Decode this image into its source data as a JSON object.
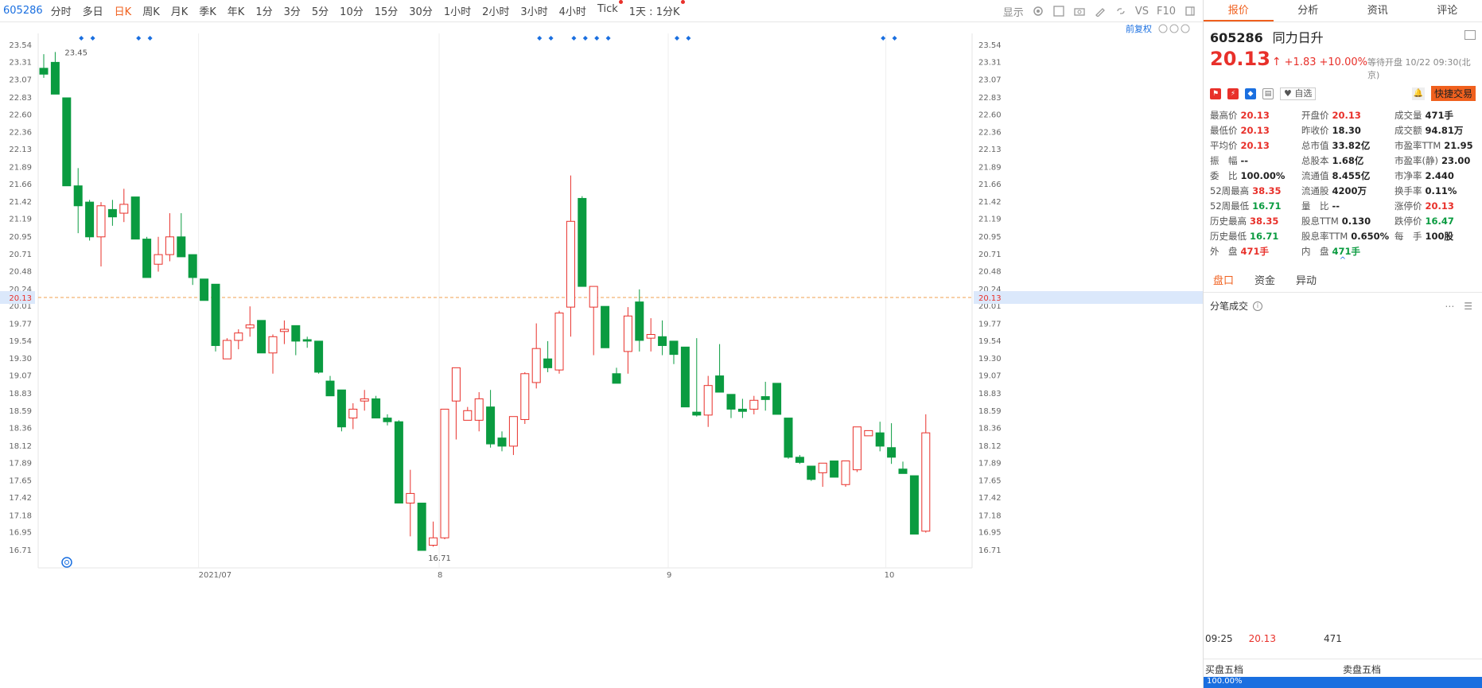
{
  "toolbar": {
    "code": "605286",
    "periods": [
      "分时",
      "多日",
      "日K",
      "周K",
      "月K",
      "季K",
      "年K",
      "1分",
      "3分",
      "5分",
      "10分",
      "15分",
      "30分",
      "1小时",
      "2小时",
      "3小时",
      "4小时",
      "Tick",
      "1天 : 1分K"
    ],
    "active_period": "日K",
    "display": "显示",
    "vs": "VS",
    "f10": "F10",
    "restore": "前复权"
  },
  "right_panel": {
    "tabs": [
      "报价",
      "分析",
      "资讯",
      "评论"
    ],
    "code": "605286",
    "name": "同力日升",
    "price": "20.13",
    "change": "+1.83",
    "change_pct": "+10.00%",
    "status": "等待开盘 10/22 09:30(北京)",
    "favorite": "自选",
    "fast_trade": "快捷交易",
    "quotes": [
      [
        {
          "l": "最高价",
          "v": "20.13",
          "c": "red"
        },
        {
          "l": "开盘价",
          "v": "20.13",
          "c": "red"
        },
        {
          "l": "成交量",
          "v": "471手",
          "c": ""
        }
      ],
      [
        {
          "l": "最低价",
          "v": "20.13",
          "c": "red"
        },
        {
          "l": "昨收价",
          "v": "18.30",
          "c": ""
        },
        {
          "l": "成交额",
          "v": "94.81万",
          "c": ""
        }
      ],
      [
        {
          "l": "平均价",
          "v": "20.13",
          "c": "red"
        },
        {
          "l": "总市值",
          "v": "33.82亿",
          "c": ""
        },
        {
          "l": "市盈率TTM",
          "v": "21.95",
          "c": ""
        }
      ],
      [
        {
          "l": "振　幅",
          "v": "--",
          "c": ""
        },
        {
          "l": "总股本",
          "v": "1.68亿",
          "c": ""
        },
        {
          "l": "市盈率(静)",
          "v": "23.00",
          "c": ""
        }
      ],
      [
        {
          "l": "委　比",
          "v": "100.00%",
          "c": ""
        },
        {
          "l": "流通值",
          "v": "8.455亿",
          "c": ""
        },
        {
          "l": "市净率",
          "v": "2.440",
          "c": ""
        }
      ],
      [
        {
          "l": "52周最高",
          "v": "38.35",
          "c": "red"
        },
        {
          "l": "流通股",
          "v": "4200万",
          "c": ""
        },
        {
          "l": "换手率",
          "v": "0.11%",
          "c": ""
        }
      ],
      [
        {
          "l": "52周最低",
          "v": "16.71",
          "c": "green"
        },
        {
          "l": "量　比",
          "v": "--",
          "c": ""
        },
        {
          "l": "涨停价",
          "v": "20.13",
          "c": "red"
        }
      ],
      [
        {
          "l": "历史最高",
          "v": "38.35",
          "c": "red"
        },
        {
          "l": "股息TTM",
          "v": "0.130",
          "c": ""
        },
        {
          "l": "跌停价",
          "v": "16.47",
          "c": "green"
        }
      ],
      [
        {
          "l": "历史最低",
          "v": "16.71",
          "c": "green"
        },
        {
          "l": "股息率TTM",
          "v": "0.650%",
          "c": ""
        },
        {
          "l": "每　手",
          "v": "100股",
          "c": ""
        }
      ],
      [
        {
          "l": "外　盘",
          "v": "471手",
          "c": "red"
        },
        {
          "l": "内　盘",
          "v": "471手",
          "c": "green"
        },
        {
          "l": "",
          "v": "",
          "c": ""
        }
      ]
    ],
    "sub_tabs": [
      "盘口",
      "资金",
      "异动"
    ],
    "trade_title": "分笔成交",
    "trade": {
      "time": "09:25",
      "price": "20.13",
      "vol": "471"
    },
    "book_buy": "买盘五档",
    "book_sell": "卖盘五档",
    "book_bar": "100.00%"
  },
  "chart_data": {
    "type": "candlestick",
    "title": "",
    "y_ticks": [
      "23.54",
      "23.31",
      "23.07",
      "22.83",
      "22.60",
      "22.36",
      "22.13",
      "21.89",
      "21.66",
      "21.42",
      "21.19",
      "20.95",
      "20.71",
      "20.48",
      "20.24",
      "20.01",
      "19.77",
      "19.54",
      "19.30",
      "19.07",
      "18.83",
      "18.59",
      "18.36",
      "18.12",
      "17.89",
      "17.65",
      "17.42",
      "17.18",
      "16.95",
      "16.71"
    ],
    "ylim": [
      16.71,
      23.54
    ],
    "x_labels": [
      {
        "label": "2021/07",
        "index": 14
      },
      {
        "label": "8",
        "index": 35
      },
      {
        "label": "9",
        "index": 55
      },
      {
        "label": "10",
        "index": 74
      }
    ],
    "last_price_line": 20.13,
    "last_price_label": "20.13",
    "max_label": "23.45",
    "min_label": "16.71",
    "candles": [
      {
        "o": 23.23,
        "h": 23.42,
        "l": 23.1,
        "c": 23.15
      },
      {
        "o": 23.31,
        "h": 23.45,
        "l": 22.88,
        "c": 22.88
      },
      {
        "o": 22.83,
        "h": 22.83,
        "l": 21.64,
        "c": 21.64
      },
      {
        "o": 21.64,
        "h": 21.88,
        "l": 21.0,
        "c": 21.37
      },
      {
        "o": 21.42,
        "h": 21.45,
        "l": 20.9,
        "c": 20.95
      },
      {
        "o": 20.95,
        "h": 21.42,
        "l": 20.55,
        "c": 21.37
      },
      {
        "o": 21.32,
        "h": 21.45,
        "l": 21.1,
        "c": 21.22
      },
      {
        "o": 21.27,
        "h": 21.6,
        "l": 21.15,
        "c": 21.39
      },
      {
        "o": 21.49,
        "h": 21.49,
        "l": 20.92,
        "c": 20.92
      },
      {
        "o": 20.92,
        "h": 20.95,
        "l": 20.4,
        "c": 20.4
      },
      {
        "o": 20.58,
        "h": 20.95,
        "l": 20.48,
        "c": 20.71
      },
      {
        "o": 20.71,
        "h": 21.27,
        "l": 20.62,
        "c": 20.95
      },
      {
        "o": 20.95,
        "h": 21.27,
        "l": 20.68,
        "c": 20.68
      },
      {
        "o": 20.71,
        "h": 20.71,
        "l": 20.3,
        "c": 20.4
      },
      {
        "o": 20.38,
        "h": 20.38,
        "l": 20.09,
        "c": 20.09
      },
      {
        "o": 20.31,
        "h": 20.31,
        "l": 19.4,
        "c": 19.48
      },
      {
        "o": 19.3,
        "h": 19.58,
        "l": 19.3,
        "c": 19.55
      },
      {
        "o": 19.55,
        "h": 19.7,
        "l": 19.43,
        "c": 19.65
      },
      {
        "o": 19.72,
        "h": 20.01,
        "l": 19.6,
        "c": 19.76
      },
      {
        "o": 19.82,
        "h": 19.82,
        "l": 19.38,
        "c": 19.38
      },
      {
        "o": 19.38,
        "h": 19.63,
        "l": 19.1,
        "c": 19.6
      },
      {
        "o": 19.67,
        "h": 19.82,
        "l": 19.5,
        "c": 19.7
      },
      {
        "o": 19.75,
        "h": 19.75,
        "l": 19.35,
        "c": 19.54
      },
      {
        "o": 19.56,
        "h": 19.6,
        "l": 19.45,
        "c": 19.54
      },
      {
        "o": 19.54,
        "h": 19.54,
        "l": 19.1,
        "c": 19.12
      },
      {
        "o": 19.0,
        "h": 19.07,
        "l": 18.8,
        "c": 18.8
      },
      {
        "o": 18.88,
        "h": 18.88,
        "l": 18.32,
        "c": 18.38
      },
      {
        "o": 18.5,
        "h": 18.7,
        "l": 18.35,
        "c": 18.62
      },
      {
        "o": 18.73,
        "h": 18.88,
        "l": 18.6,
        "c": 18.76
      },
      {
        "o": 18.76,
        "h": 18.8,
        "l": 18.5,
        "c": 18.5
      },
      {
        "o": 18.5,
        "h": 18.55,
        "l": 18.4,
        "c": 18.45
      },
      {
        "o": 18.45,
        "h": 18.47,
        "l": 17.35,
        "c": 17.35
      },
      {
        "o": 17.35,
        "h": 17.8,
        "l": 16.9,
        "c": 17.48
      },
      {
        "o": 17.35,
        "h": 17.35,
        "l": 16.71,
        "c": 16.71
      },
      {
        "o": 16.78,
        "h": 17.1,
        "l": 16.76,
        "c": 16.88
      },
      {
        "o": 16.88,
        "h": 18.62,
        "l": 16.86,
        "c": 18.62
      },
      {
        "o": 18.73,
        "h": 19.18,
        "l": 18.21,
        "c": 19.18
      },
      {
        "o": 18.47,
        "h": 18.65,
        "l": 18.47,
        "c": 18.6
      },
      {
        "o": 18.47,
        "h": 18.85,
        "l": 18.32,
        "c": 18.76
      },
      {
        "o": 18.65,
        "h": 18.88,
        "l": 18.1,
        "c": 18.15
      },
      {
        "o": 18.23,
        "h": 18.32,
        "l": 18.05,
        "c": 18.12
      },
      {
        "o": 18.12,
        "h": 18.5,
        "l": 18.0,
        "c": 18.52
      },
      {
        "o": 18.48,
        "h": 19.12,
        "l": 18.42,
        "c": 19.1
      },
      {
        "o": 18.98,
        "h": 19.78,
        "l": 18.9,
        "c": 19.44
      },
      {
        "o": 19.3,
        "h": 19.54,
        "l": 19.12,
        "c": 19.18
      },
      {
        "o": 19.15,
        "h": 19.95,
        "l": 19.1,
        "c": 19.92
      },
      {
        "o": 20.0,
        "h": 21.78,
        "l": 19.6,
        "c": 21.16
      },
      {
        "o": 21.47,
        "h": 21.5,
        "l": 20.28,
        "c": 20.28
      },
      {
        "o": 20.0,
        "h": 20.28,
        "l": 19.35,
        "c": 20.28
      },
      {
        "o": 20.01,
        "h": 20.01,
        "l": 19.45,
        "c": 19.45
      },
      {
        "o": 19.1,
        "h": 19.18,
        "l": 18.97,
        "c": 18.97
      },
      {
        "o": 19.4,
        "h": 20.0,
        "l": 19.1,
        "c": 19.88
      },
      {
        "o": 20.07,
        "h": 20.24,
        "l": 19.4,
        "c": 19.55
      },
      {
        "o": 19.58,
        "h": 19.85,
        "l": 19.4,
        "c": 19.63
      },
      {
        "o": 19.6,
        "h": 19.82,
        "l": 19.35,
        "c": 19.48
      },
      {
        "o": 19.54,
        "h": 19.54,
        "l": 19.23,
        "c": 19.36
      },
      {
        "o": 19.46,
        "h": 19.46,
        "l": 18.65,
        "c": 18.65
      },
      {
        "o": 18.58,
        "h": 19.58,
        "l": 18.52,
        "c": 18.54
      },
      {
        "o": 18.54,
        "h": 19.07,
        "l": 18.38,
        "c": 18.94
      },
      {
        "o": 19.07,
        "h": 19.5,
        "l": 18.85,
        "c": 18.85
      },
      {
        "o": 18.82,
        "h": 18.82,
        "l": 18.5,
        "c": 18.62
      },
      {
        "o": 18.62,
        "h": 18.76,
        "l": 18.5,
        "c": 18.59
      },
      {
        "o": 18.62,
        "h": 18.8,
        "l": 18.55,
        "c": 18.74
      },
      {
        "o": 18.79,
        "h": 18.99,
        "l": 18.6,
        "c": 18.75
      },
      {
        "o": 18.97,
        "h": 18.97,
        "l": 18.55,
        "c": 18.55
      },
      {
        "o": 18.5,
        "h": 18.5,
        "l": 17.95,
        "c": 17.97
      },
      {
        "o": 17.97,
        "h": 18.0,
        "l": 17.88,
        "c": 17.9
      },
      {
        "o": 17.85,
        "h": 17.85,
        "l": 17.65,
        "c": 17.67
      },
      {
        "o": 17.76,
        "h": 17.88,
        "l": 17.57,
        "c": 17.89
      },
      {
        "o": 17.92,
        "h": 17.92,
        "l": 17.7,
        "c": 17.7
      },
      {
        "o": 17.6,
        "h": 17.92,
        "l": 17.57,
        "c": 17.92
      },
      {
        "o": 17.8,
        "h": 18.38,
        "l": 17.77,
        "c": 18.38
      },
      {
        "o": 18.26,
        "h": 18.33,
        "l": 18.26,
        "c": 18.33
      },
      {
        "o": 18.3,
        "h": 18.45,
        "l": 18.05,
        "c": 18.12
      },
      {
        "o": 18.1,
        "h": 18.43,
        "l": 17.88,
        "c": 17.97
      },
      {
        "o": 17.81,
        "h": 17.91,
        "l": 17.75,
        "c": 17.75
      },
      {
        "o": 17.72,
        "h": 17.72,
        "l": 16.93,
        "c": 16.93
      },
      {
        "o": 16.97,
        "h": 18.55,
        "l": 16.95,
        "c": 18.3
      }
    ],
    "markers": [
      3,
      4,
      8,
      9,
      43,
      44,
      46,
      47,
      48,
      49,
      55,
      56,
      73,
      74
    ]
  }
}
